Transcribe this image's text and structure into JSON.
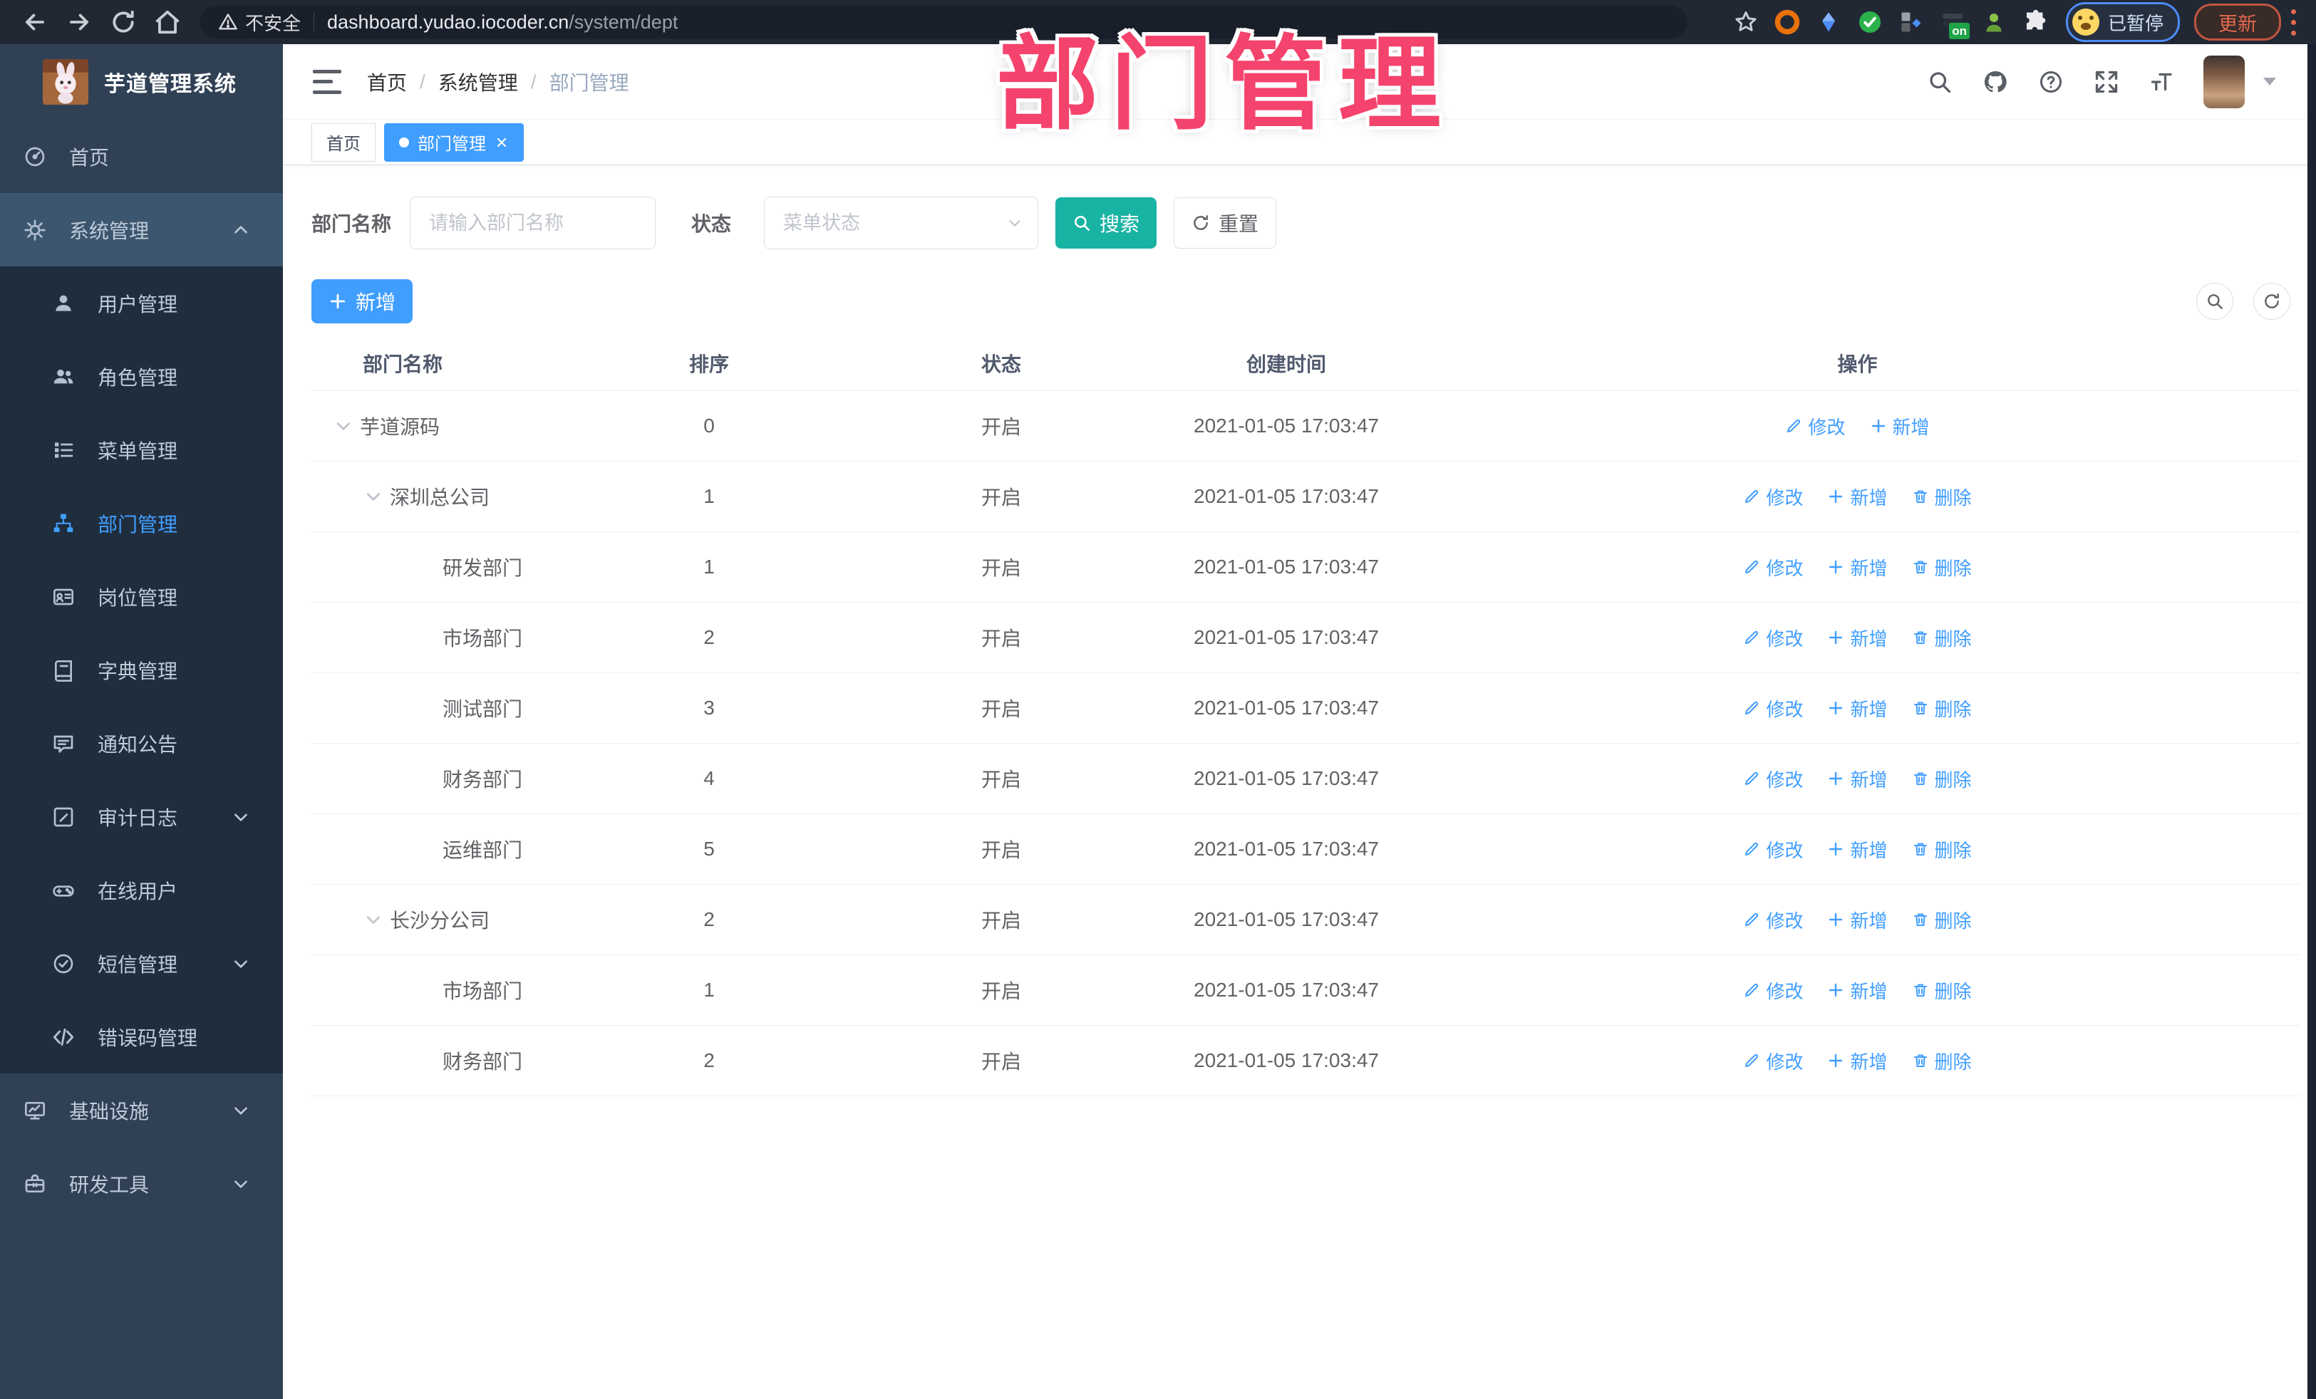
{
  "browser": {
    "security_label": "不安全",
    "url_host": "dashboard.yudao.iocoder.cn",
    "url_path": "/system/dept",
    "profile_status": "已暂停",
    "update_label": "更新",
    "extension_badge": "on"
  },
  "app": {
    "title": "芋道管理系统"
  },
  "overlay": {
    "title": "部门管理"
  },
  "header": {
    "breadcrumb": [
      "首页",
      "系统管理",
      "部门管理"
    ],
    "breadcrumb_separator": "/"
  },
  "tabs": [
    {
      "label": "首页",
      "active": false
    },
    {
      "label": "部门管理",
      "active": true
    }
  ],
  "filters": {
    "dept_label": "部门名称",
    "dept_placeholder": "请输入部门名称",
    "status_label": "状态",
    "status_placeholder": "菜单状态",
    "search_label": "搜索",
    "reset_label": "重置"
  },
  "toolbar": {
    "add_label": "新增"
  },
  "sidebar": {
    "home": "首页",
    "system": "系统管理",
    "system_children": [
      {
        "label": "用户管理"
      },
      {
        "label": "角色管理"
      },
      {
        "label": "菜单管理"
      },
      {
        "label": "部门管理",
        "active": true
      },
      {
        "label": "岗位管理"
      },
      {
        "label": "字典管理"
      },
      {
        "label": "通知公告"
      },
      {
        "label": "审计日志",
        "expandable": true
      },
      {
        "label": "在线用户"
      },
      {
        "label": "短信管理",
        "expandable": true
      },
      {
        "label": "错误码管理"
      }
    ],
    "infra": "基础设施",
    "devtools": "研发工具"
  },
  "table": {
    "headers": [
      "部门名称",
      "排序",
      "状态",
      "创建时间",
      "操作"
    ],
    "actions": {
      "edit": "修改",
      "add": "新增",
      "del": "删除"
    },
    "rows": [
      {
        "name": "芋道源码",
        "level": 0,
        "expanded": true,
        "sort": "0",
        "status": "开启",
        "created": "2021-01-05 17:03:47",
        "deletable": false
      },
      {
        "name": "深圳总公司",
        "level": 1,
        "expanded": true,
        "sort": "1",
        "status": "开启",
        "created": "2021-01-05 17:03:47",
        "deletable": true
      },
      {
        "name": "研发部门",
        "level": 2,
        "expanded": false,
        "sort": "1",
        "status": "开启",
        "created": "2021-01-05 17:03:47",
        "deletable": true
      },
      {
        "name": "市场部门",
        "level": 2,
        "expanded": false,
        "sort": "2",
        "status": "开启",
        "created": "2021-01-05 17:03:47",
        "deletable": true
      },
      {
        "name": "测试部门",
        "level": 2,
        "expanded": false,
        "sort": "3",
        "status": "开启",
        "created": "2021-01-05 17:03:47",
        "deletable": true
      },
      {
        "name": "财务部门",
        "level": 2,
        "expanded": false,
        "sort": "4",
        "status": "开启",
        "created": "2021-01-05 17:03:47",
        "deletable": true
      },
      {
        "name": "运维部门",
        "level": 2,
        "expanded": false,
        "sort": "5",
        "status": "开启",
        "created": "2021-01-05 17:03:47",
        "deletable": true
      },
      {
        "name": "长沙分公司",
        "level": 1,
        "expanded": true,
        "sort": "2",
        "status": "开启",
        "created": "2021-01-05 17:03:47",
        "deletable": true
      },
      {
        "name": "市场部门",
        "level": 2,
        "expanded": false,
        "sort": "1",
        "status": "开启",
        "created": "2021-01-05 17:03:47",
        "deletable": true
      },
      {
        "name": "财务部门",
        "level": 2,
        "expanded": false,
        "sort": "2",
        "status": "开启",
        "created": "2021-01-05 17:03:47",
        "deletable": true
      }
    ]
  },
  "colors": {
    "accent_blue": "#409EFF",
    "search_teal": "#18B3A3",
    "sidebar_bg": "#304156",
    "submenu_bg": "#1F2D3D",
    "chrome_bar": "#212834",
    "overlay_pink": "#F4436C"
  },
  "icons": {
    "back-icon": "left arrow",
    "forward-icon": "right arrow",
    "reload-icon": "circular arrow",
    "home-icon": "house",
    "warning-icon": "triangle !",
    "bookmark-star-icon": "star outline",
    "extensions-puzzle-icon": "puzzle piece",
    "search-icon": "magnifier",
    "github-icon": "octocat",
    "help-icon": "question circle",
    "fullscreen-icon": "expand arrows",
    "font-size-icon": "TT",
    "hamburger-icon": "three bars",
    "close-icon": "x",
    "caret-down-icon": "chevron",
    "edit-icon": "pencil",
    "plus-icon": "plus",
    "delete-icon": "trash",
    "refresh-icon": "circular arrow"
  }
}
